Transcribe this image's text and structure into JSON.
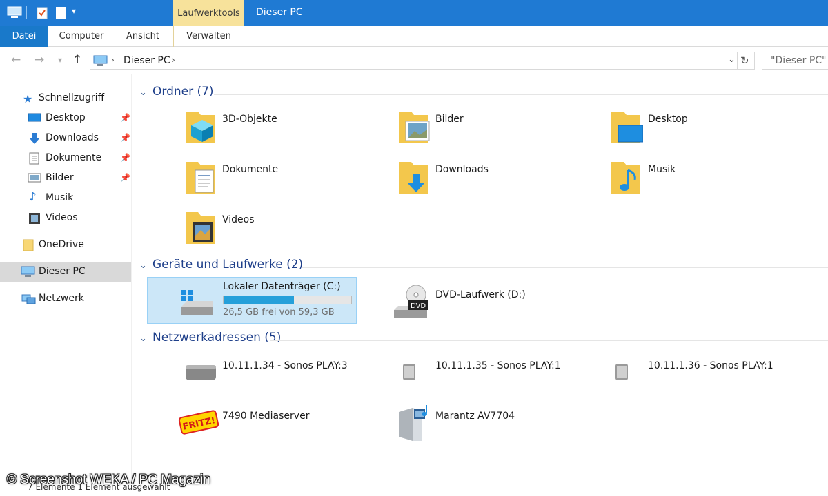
{
  "titlebar": {
    "context_tab": "Laufwerktools",
    "title": "Dieser PC"
  },
  "ribbon": {
    "tabs": [
      "Datei",
      "Computer",
      "Ansicht",
      "Verwalten"
    ]
  },
  "address": {
    "path": "Dieser PC",
    "search_placeholder": "\"Dieser PC\" d"
  },
  "sidebar": {
    "quick_access": "Schnellzugriff",
    "items": [
      "Desktop",
      "Downloads",
      "Dokumente",
      "Bilder",
      "Musik",
      "Videos"
    ],
    "onedrive": "OneDrive",
    "this_pc": "Dieser PC",
    "network": "Netzwerk"
  },
  "groups": {
    "folders": {
      "title": "Ordner (7)",
      "items": [
        "3D-Objekte",
        "Bilder",
        "Desktop",
        "Dokumente",
        "Downloads",
        "Musik",
        "Videos"
      ]
    },
    "drives": {
      "title": "Geräte und Laufwerke (2)",
      "local": {
        "label": "Lokaler Datenträger (C:)",
        "free_text": "26,5 GB frei von 59,3 GB",
        "used_fraction": 0.553
      },
      "dvd": {
        "label": "DVD-Laufwerk (D:)",
        "badge": "DVD"
      }
    },
    "network": {
      "title": "Netzwerkadressen (5)",
      "items": [
        "10.11.1.34 - Sonos PLAY:3",
        "10.11.1.35 - Sonos PLAY:1",
        "10.11.1.36 - Sonos PLAY:1",
        "7490 Mediaserver",
        "Marantz AV7704"
      ],
      "fritz_logo": "FRITZ!"
    }
  },
  "statusbar": {
    "text": "7 Elemente   1 Element ausgewählt"
  },
  "watermark": "© Screenshot WEKA / PC Magazin",
  "colors": {
    "titlebar": "#1f7ad3",
    "context_tab": "#f7e29b",
    "file_tab": "#1979ca",
    "selection": "#cce7f8",
    "progress": "#26a0da",
    "group_title": "#1e3f8a"
  }
}
